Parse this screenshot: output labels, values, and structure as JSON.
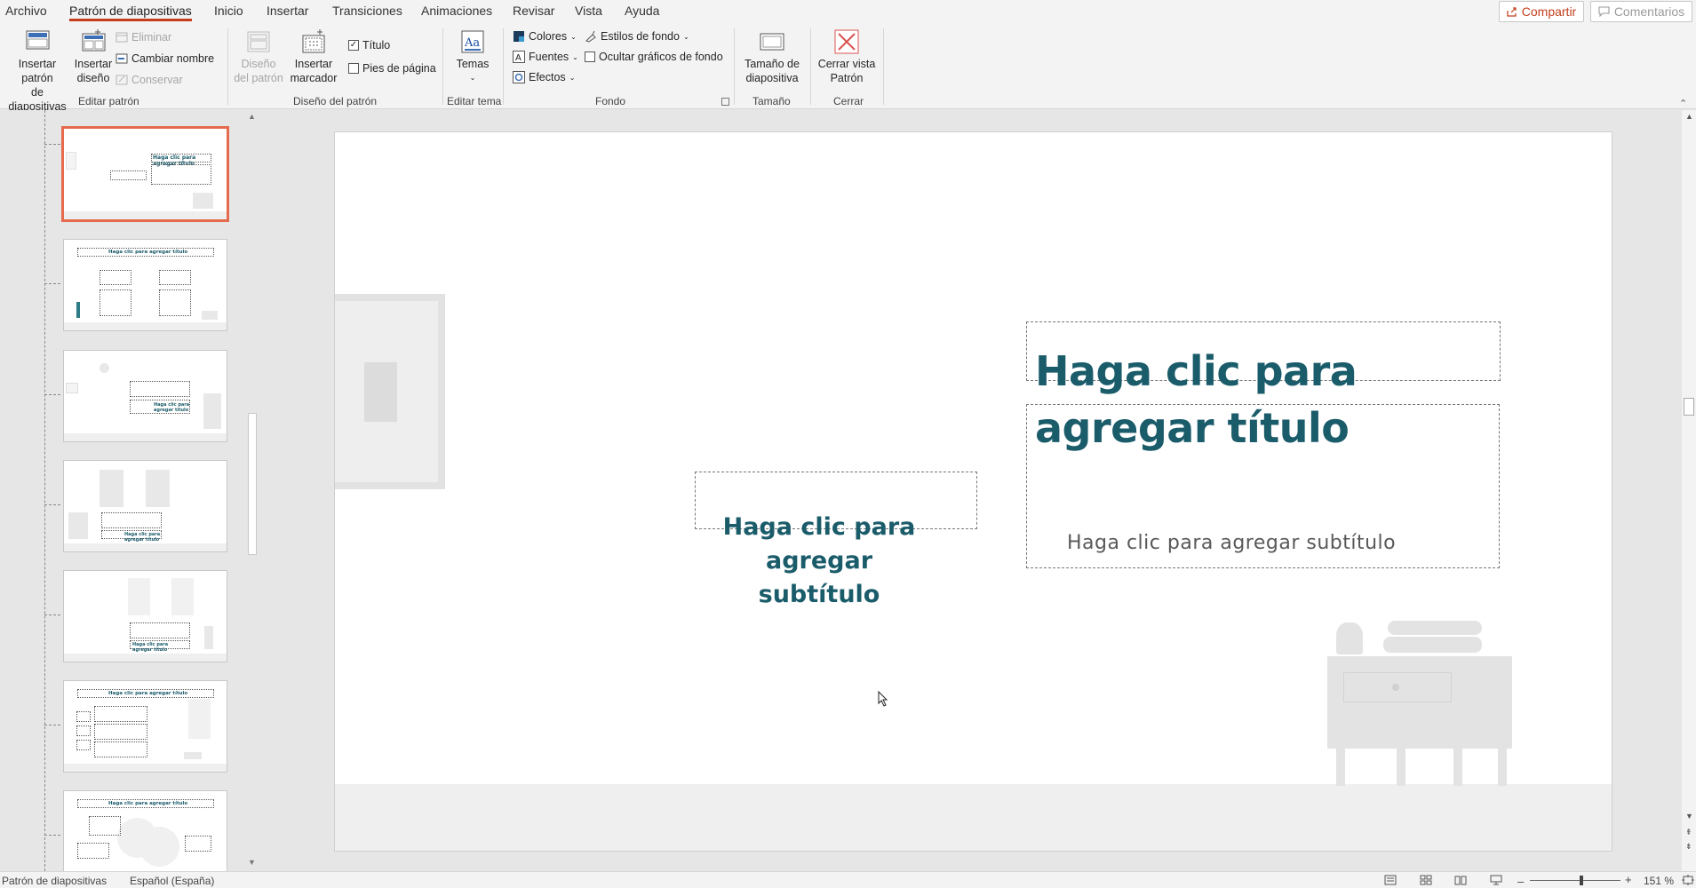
{
  "menu": {
    "tabs": [
      "Archivo",
      "Patrón de diapositivas",
      "Inicio",
      "Insertar",
      "Transiciones",
      "Animaciones",
      "Revisar",
      "Vista",
      "Ayuda"
    ],
    "active_tab": "Patrón de diapositivas",
    "share_label": "Compartir",
    "comments_label": "Comentarios"
  },
  "ribbon": {
    "editar_patron": {
      "label": "Editar patrón",
      "insert_master_l1": "Insertar patrón",
      "insert_master_l2": "de diapositivas",
      "insert_layout_l1": "Insertar",
      "insert_layout_l2": "diseño",
      "delete": "Eliminar",
      "rename": "Cambiar nombre",
      "preserve": "Conservar"
    },
    "diseno_patron": {
      "label": "Diseño del patrón",
      "master_layout_l1": "Diseño",
      "master_layout_l2": "del patrón",
      "insert_placeholder_l1": "Insertar",
      "insert_placeholder_l2": "marcador",
      "title_check": "Título",
      "footers_check": "Pies de página"
    },
    "editar_tema": {
      "label": "Editar tema",
      "themes": "Temas"
    },
    "fondo": {
      "label": "Fondo",
      "colors": "Colores",
      "fonts": "Fuentes",
      "effects": "Efectos",
      "bg_styles": "Estilos de fondo",
      "hide_bg": "Ocultar gráficos de fondo"
    },
    "tamano": {
      "label": "Tamaño",
      "slide_size_l1": "Tamaño de",
      "slide_size_l2": "diapositiva"
    },
    "cerrar": {
      "label": "Cerrar",
      "close_l1": "Cerrar vista",
      "close_l2": "Patrón"
    }
  },
  "thumbnails": {
    "title_text": "Haga clic para agregar título",
    "title_l1": "Haga clic para",
    "title_l2": "agregar título",
    "mini_sub": "Haga clic para agregar subtítulo"
  },
  "slide": {
    "title_line1": "Haga clic para",
    "title_line2": "agregar título",
    "subtitle": "Haga clic para agregar subtítulo",
    "mid_line1": "Haga clic para",
    "mid_line2": "agregar",
    "mid_line3": "subtítulo"
  },
  "status": {
    "view": "Patrón de diapositivas",
    "language": "Español (España)",
    "zoom": "151 %",
    "zoom_minus": "–",
    "zoom_plus": "+"
  },
  "colors": {
    "accent": "#c43e1c",
    "title_teal": "#1b5c6b",
    "selection": "#e56b4e"
  },
  "icons": [
    "share-icon",
    "comments-icon",
    "insert-master-icon",
    "insert-layout-icon",
    "delete-icon",
    "rename-icon",
    "preserve-icon",
    "master-layout-icon",
    "insert-placeholder-icon",
    "themes-icon",
    "colors-icon",
    "fonts-icon",
    "effects-icon",
    "bg-styles-icon",
    "slide-size-icon",
    "close-master-icon",
    "cursor-icon"
  ]
}
